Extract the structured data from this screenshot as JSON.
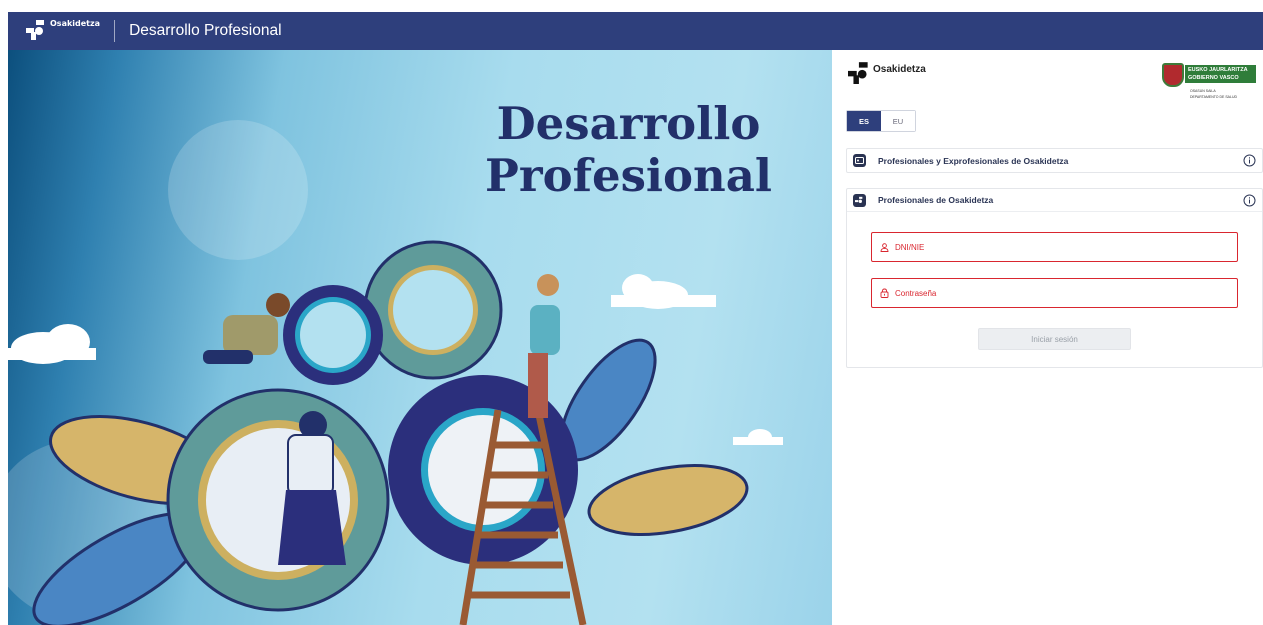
{
  "header": {
    "logo_text": "Osakidetza",
    "app_title": "Desarrollo Profesional"
  },
  "hero": {
    "title_line1": "Desarrollo",
    "title_line2": "Profesional"
  },
  "panel": {
    "brand_text": "Osakidetza",
    "gov": {
      "name_line1": "EUSKO JAURLARITZA",
      "name_line2": "GOBIERNO VASCO",
      "dept_line1": "OSASUN SAILA",
      "dept_line2": "DEPARTAMENTO DE SALUD"
    },
    "languages": [
      {
        "label": "ES",
        "active": true
      },
      {
        "label": "EU",
        "active": false
      }
    ],
    "sections": [
      {
        "label": "Profesionales y Exprofesionales de Osakidetza",
        "icon": "id-card-icon",
        "expanded": false
      },
      {
        "label": "Profesionales de Osakidetza",
        "icon": "osakidetza-icon",
        "expanded": true
      }
    ],
    "form": {
      "dni_placeholder": "DNI/NIE",
      "password_placeholder": "Contraseña",
      "login_label": "Iniciar sesión"
    }
  },
  "colors": {
    "brand_navy": "#2e3f7c",
    "error_red": "#d9262f",
    "gov_green": "#2f7d3a"
  }
}
